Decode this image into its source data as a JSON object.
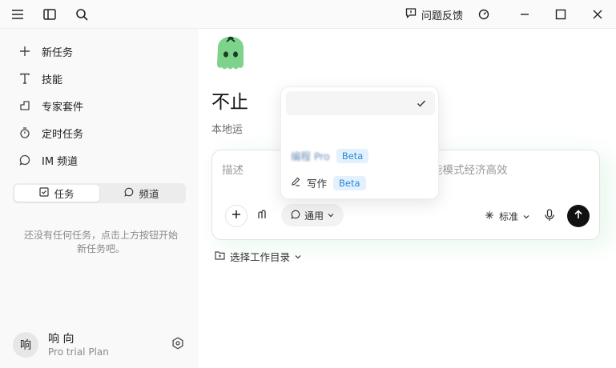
{
  "topbar": {
    "menu_icon": "menu-icon",
    "sidebar_icon": "sidebar-toggle-icon",
    "search_icon": "search-icon",
    "feedback_label": "问题反馈",
    "gauge_icon": "gauge-icon"
  },
  "sidebar": {
    "items": [
      {
        "label": "新任务",
        "icon": "plus-icon"
      },
      {
        "label": "技能",
        "icon": "text-icon"
      },
      {
        "label": "专家套件",
        "icon": "cube-icon"
      },
      {
        "label": "定时任务",
        "icon": "timer-icon"
      },
      {
        "label": "IM 频道",
        "icon": "chat-icon"
      }
    ],
    "segment": {
      "tasks": "任务",
      "channels": "频道"
    },
    "empty_message_line1": "还没有任何任务，点击上方按钮开始",
    "empty_message_line2": "新任务吧。",
    "user": {
      "avatar_char": "响",
      "name": "响 向",
      "plan": "Pro trial Plan"
    }
  },
  "main": {
    "headline": "不止",
    "subline": "本地运",
    "input": {
      "placeholder_left": "描述",
      "placeholder_right": "能模式经济高效"
    },
    "mode_label": "通用",
    "standard_label": "标准",
    "workdir_label": "选择工作目录"
  },
  "dropdown": {
    "item_blurred_label": "编程 Pro",
    "item_blurred_badge": "Beta",
    "item_writing_label": "写作",
    "item_writing_badge": "Beta"
  },
  "colors": {
    "logo_green": "#7dd38b",
    "beta_bg": "#e2f1fd",
    "beta_text": "#2a8ad6",
    "send_bg": "#111111"
  }
}
